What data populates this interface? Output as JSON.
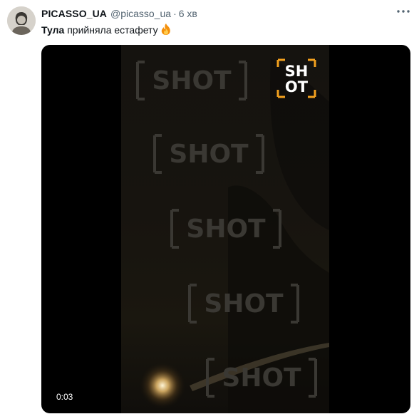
{
  "tweet": {
    "author_name": "PICASSO_UA",
    "author_handle": "@picasso_ua",
    "separator": "·",
    "time": "6 хв",
    "text_bold": "Тула",
    "text_rest": " прийняла естафету",
    "emoji": "fire"
  },
  "video": {
    "timestamp": "0:03",
    "watermark_text": "SHOT",
    "logo_lines": [
      "SH",
      "OT"
    ]
  },
  "colors": {
    "text": "#0f1419",
    "secondary": "#536471",
    "media_background": "#000000"
  },
  "icons": [
    "avatar",
    "more-icon",
    "fire-emoji-icon",
    "shot-logo",
    "shot-watermark"
  ]
}
